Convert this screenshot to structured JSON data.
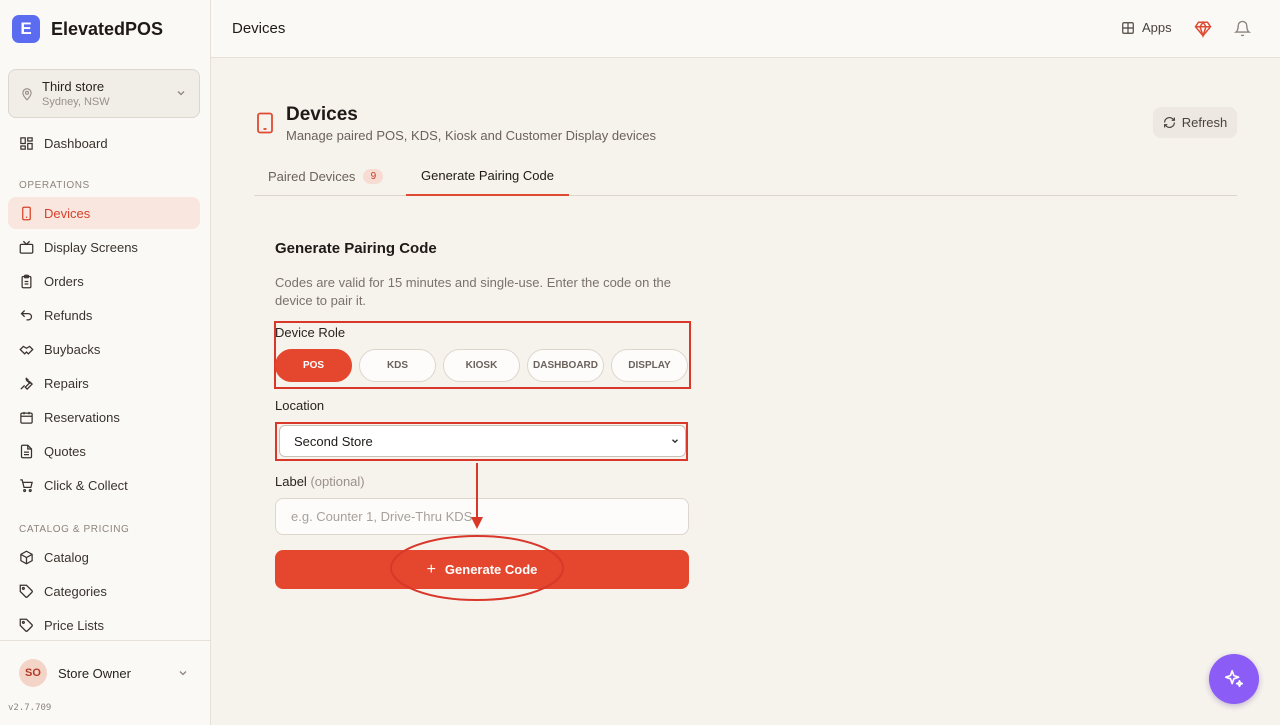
{
  "brand": {
    "logo_letter": "E",
    "name": "ElevatedPOS"
  },
  "store": {
    "name": "Third store",
    "location": "Sydney, NSW"
  },
  "nav": {
    "dashboard": "Dashboard",
    "section_operations": "OPERATIONS",
    "devices": "Devices",
    "display_screens": "Display Screens",
    "orders": "Orders",
    "refunds": "Refunds",
    "buybacks": "Buybacks",
    "repairs": "Repairs",
    "reservations": "Reservations",
    "quotes": "Quotes",
    "click_collect": "Click & Collect",
    "section_catalog": "CATALOG & PRICING",
    "catalog": "Catalog",
    "categories": "Categories",
    "price_lists": "Price Lists"
  },
  "user": {
    "initials": "SO",
    "name": "Store Owner",
    "version": "v2.7.709"
  },
  "header": {
    "title": "Devices",
    "apps_label": "Apps"
  },
  "page": {
    "title": "Devices",
    "subtitle": "Manage paired POS, KDS, Kiosk and Customer Display devices",
    "refresh_label": "Refresh"
  },
  "tabs": {
    "paired_label": "Paired Devices",
    "paired_count": "9",
    "generate_label": "Generate Pairing Code"
  },
  "form": {
    "title": "Generate Pairing Code",
    "description": "Codes are valid for 15 minutes and single-use. Enter the code on the device to pair it.",
    "role_label": "Device Role",
    "roles": [
      "POS",
      "KDS",
      "KIOSK",
      "DASHBOARD",
      "DISPLAY"
    ],
    "selected_role": "POS",
    "location_label": "Location",
    "location_value": "Second Store",
    "label_label": "Label",
    "label_optional": "(optional)",
    "label_placeholder": "e.g. Counter 1, Drive-Thru KDS",
    "generate_label": "Generate Code"
  },
  "colors": {
    "accent": "#e4472d",
    "brand_logo": "#5b6cf0",
    "annotation": "#d8372a",
    "ai_button": "#8b5cf6"
  }
}
